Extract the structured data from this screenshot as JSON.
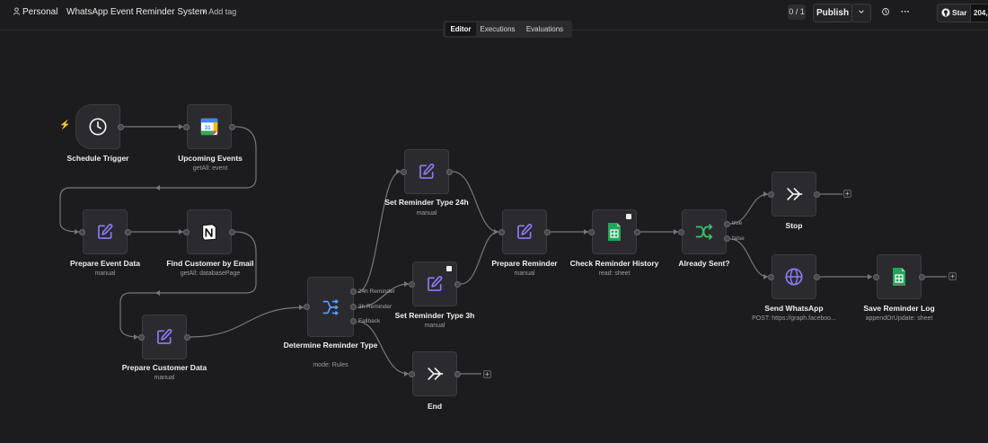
{
  "header": {
    "workspace": "Personal",
    "workflow_name": "WhatsApp Event Reminder System",
    "add_tag": "+ Add tag",
    "counter": "0 / 1",
    "publish": "Publish",
    "star": "Star",
    "star_count": "204,"
  },
  "tabs": [
    "Editor",
    "Executions",
    "Evaluations"
  ],
  "nodes": {
    "schedule_trigger": {
      "label": "Schedule Trigger",
      "sub": ""
    },
    "upcoming_events": {
      "label": "Upcoming Events",
      "sub": "getAll: event"
    },
    "prepare_event_data": {
      "label": "Prepare Event Data",
      "sub": "manual"
    },
    "find_customer": {
      "label": "Find Customer by Email",
      "sub": "getAll: databasePage"
    },
    "prepare_customer_data": {
      "label": "Prepare Customer Data",
      "sub": "manual"
    },
    "determine_reminder": {
      "label": "Determine Reminder Type",
      "sub": "mode: Rules"
    },
    "set_24h": {
      "label": "Set Reminder Type 24h",
      "sub": "manual"
    },
    "set_3h": {
      "label": "Set Reminder Type 3h",
      "sub": "manual"
    },
    "end": {
      "label": "End",
      "sub": ""
    },
    "prepare_reminder": {
      "label": "Prepare Reminder",
      "sub": "manual"
    },
    "check_history": {
      "label": "Check Reminder History",
      "sub": "read: sheet"
    },
    "already_sent": {
      "label": "Already Sent?",
      "sub": ""
    },
    "stop": {
      "label": "Stop",
      "sub": ""
    },
    "send_whatsapp": {
      "label": "Send WhatsApp",
      "sub": "POST: https://graph.faceboo..."
    },
    "save_log": {
      "label": "Save Reminder Log",
      "sub": "appendOrUpdate: sheet"
    }
  },
  "outputs": {
    "switch": [
      "24h Reminder",
      "3h Reminder",
      "Fallback"
    ],
    "if": [
      "true",
      "false"
    ]
  },
  "colors": {
    "edit_purple": "#8b7cf6",
    "switch_blue": "#5aa0ff",
    "if_green": "#35c46a",
    "sheets_green": "#22a55b",
    "trigger_bolt": "#ff6d5a"
  },
  "icons": {
    "trigger": "clock-icon",
    "calendar": "google-calendar-icon",
    "edit": "pencil-edit-icon",
    "notion": "notion-icon",
    "switch": "switch-icon",
    "noop": "double-chevron-right-icon",
    "sheets": "google-sheets-icon",
    "if": "if-branch-icon",
    "http": "globe-icon"
  }
}
